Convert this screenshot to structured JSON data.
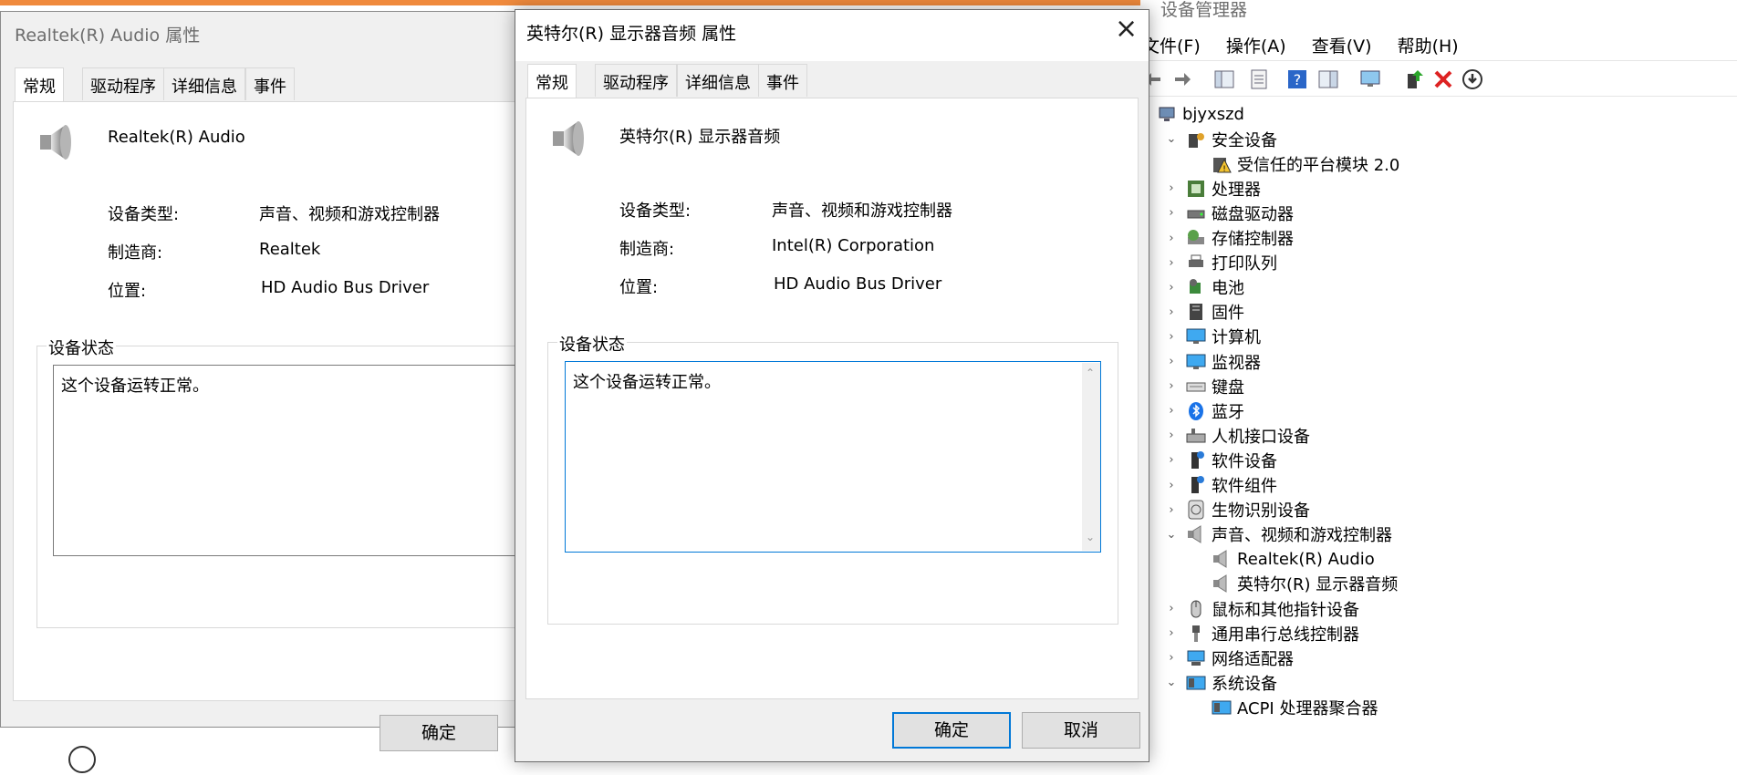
{
  "dialog_back": {
    "title": "Realtek(R) Audio 属性",
    "tabs": [
      "常规",
      "驱动程序",
      "详细信息",
      "事件"
    ],
    "device_name": "Realtek(R) Audio",
    "rows": [
      {
        "label": "设备类型:",
        "value": "声音、视频和游戏控制器"
      },
      {
        "label": "制造商:",
        "value": "Realtek"
      },
      {
        "label": "位置:",
        "value": "HD Audio Bus Driver"
      }
    ],
    "status_group": "设备状态",
    "status_text": "这个设备运转正常。",
    "ok_label": "确定"
  },
  "dialog_front": {
    "title": "英特尔(R) 显示器音频 属性",
    "tabs": [
      "常规",
      "驱动程序",
      "详细信息",
      "事件"
    ],
    "device_name": "英特尔(R) 显示器音频",
    "rows": [
      {
        "label": "设备类型:",
        "value": "声音、视频和游戏控制器"
      },
      {
        "label": "制造商:",
        "value": "Intel(R) Corporation"
      },
      {
        "label": "位置:",
        "value": "HD Audio Bus Driver"
      }
    ],
    "status_group": "设备状态",
    "status_text": "这个设备运转正常。",
    "ok_label": "确定",
    "cancel_label": "取消",
    "close_icon": "×"
  },
  "device_manager": {
    "title": "设备管理器",
    "menu": [
      "文件(F)",
      "操作(A)",
      "查看(V)",
      "帮助(H)"
    ],
    "tree": [
      {
        "label": "bjyxszd",
        "level": 0,
        "chev": "",
        "icon": "computer-root"
      },
      {
        "label": "安全设备",
        "level": 1,
        "chev": "⌄",
        "icon": "security"
      },
      {
        "label": "受信任的平台模块 2.0",
        "level": 2,
        "chev": "",
        "icon": "warning"
      },
      {
        "label": "处理器",
        "level": 1,
        "chev": "›",
        "icon": "cpu"
      },
      {
        "label": "磁盘驱动器",
        "level": 1,
        "chev": "›",
        "icon": "disk"
      },
      {
        "label": "存储控制器",
        "level": 1,
        "chev": "›",
        "icon": "storage"
      },
      {
        "label": "打印队列",
        "level": 1,
        "chev": "›",
        "icon": "printer"
      },
      {
        "label": "电池",
        "level": 1,
        "chev": "›",
        "icon": "battery"
      },
      {
        "label": "固件",
        "level": 1,
        "chev": "›",
        "icon": "firmware"
      },
      {
        "label": "计算机",
        "level": 1,
        "chev": "›",
        "icon": "monitor"
      },
      {
        "label": "监视器",
        "level": 1,
        "chev": "›",
        "icon": "monitor"
      },
      {
        "label": "键盘",
        "level": 1,
        "chev": "›",
        "icon": "keyboard"
      },
      {
        "label": "蓝牙",
        "level": 1,
        "chev": "›",
        "icon": "bluetooth"
      },
      {
        "label": "人机接口设备",
        "level": 1,
        "chev": "›",
        "icon": "hid"
      },
      {
        "label": "软件设备",
        "level": 1,
        "chev": "›",
        "icon": "software"
      },
      {
        "label": "软件组件",
        "level": 1,
        "chev": "›",
        "icon": "software"
      },
      {
        "label": "生物识别设备",
        "level": 1,
        "chev": "›",
        "icon": "fingerprint"
      },
      {
        "label": "声音、视频和游戏控制器",
        "level": 1,
        "chev": "⌄",
        "icon": "speaker"
      },
      {
        "label": "Realtek(R) Audio",
        "level": 2,
        "chev": "",
        "icon": "speaker"
      },
      {
        "label": "英特尔(R) 显示器音频",
        "level": 2,
        "chev": "",
        "icon": "speaker"
      },
      {
        "label": "鼠标和其他指针设备",
        "level": 1,
        "chev": "›",
        "icon": "mouse"
      },
      {
        "label": "通用串行总线控制器",
        "level": 1,
        "chev": "›",
        "icon": "usb"
      },
      {
        "label": "网络适配器",
        "level": 1,
        "chev": "›",
        "icon": "network"
      },
      {
        "label": "系统设备",
        "level": 1,
        "chev": "⌄",
        "icon": "system"
      },
      {
        "label": "ACPI 处理器聚合器",
        "level": 2,
        "chev": "",
        "icon": "system"
      }
    ]
  }
}
